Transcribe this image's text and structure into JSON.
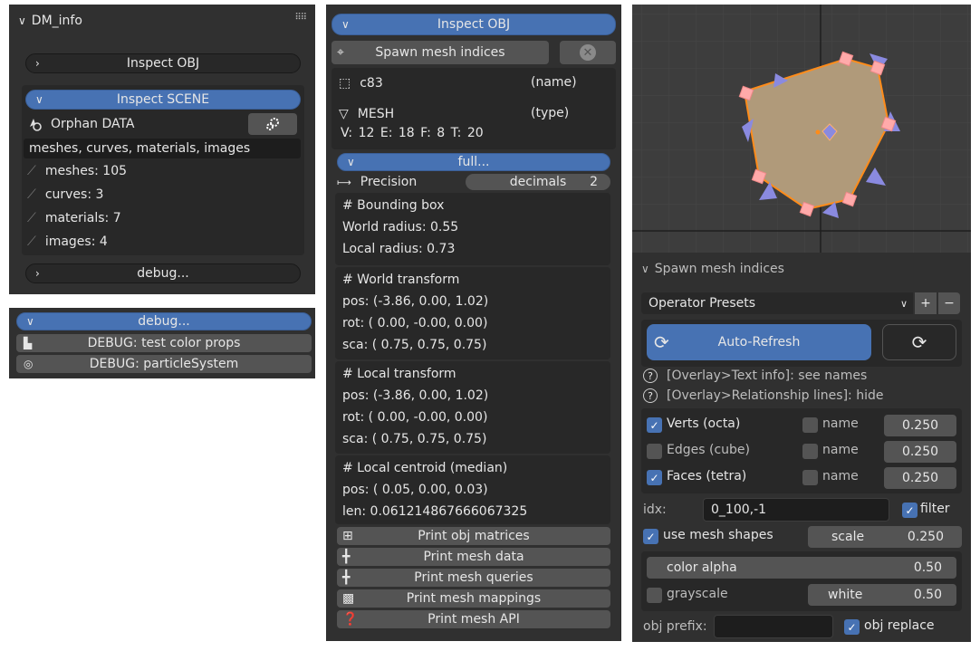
{
  "left": {
    "title": "DM_info",
    "inspect_obj": "Inspect OBJ",
    "inspect_scene": "Inspect SCENE",
    "orphan_label": "Orphan DATA",
    "types_text": "meshes, curves, materials, images",
    "counts": [
      "meshes: 105",
      "curves: 3",
      "materials: 7",
      "images: 4"
    ],
    "debug": "debug..."
  },
  "debug_panel": {
    "header": "debug...",
    "items": [
      "DEBUG: test color props",
      "DEBUG: particleSystem"
    ]
  },
  "middle": {
    "header": "Inspect OBJ",
    "spawn": "Spawn mesh indices",
    "obj_name": "c83",
    "name_tag": "(name)",
    "obj_type": "MESH",
    "type_tag": "(type)",
    "stats": "V: 12   E: 18   F: 8   T: 20",
    "full": "full...",
    "precision_label": "Precision",
    "decimals_label": "decimals",
    "decimals_value": "2",
    "bbox": [
      "# Bounding box",
      "World radius:  0.55",
      "Local radius:  0.73"
    ],
    "world": [
      "# World transform",
      "pos: (-3.86,  0.00,  1.02)",
      "rot:  ( 0.00, -0.00,  0.00)",
      "sca:  ( 0.75,  0.75,  0.75)"
    ],
    "local": [
      "# Local transform",
      "pos: (-3.86,  0.00,  1.02)",
      "rot:  ( 0.00, -0.00,  0.00)",
      "sca:  ( 0.75,  0.75,  0.75)"
    ],
    "centroid": [
      "# Local centroid (median)",
      "pos: ( 0.05,  0.00,  0.03)",
      "len: 0.061214867666067325"
    ],
    "print_buttons": [
      "Print obj matrices",
      "Print mesh data",
      "Print mesh queries",
      "Print mesh mappings",
      "Print mesh API"
    ]
  },
  "right": {
    "panel_title": "Spawn mesh indices",
    "presets": "Operator Presets",
    "plus": "+",
    "minus": "−",
    "auto_refresh": "Auto-Refresh",
    "info1": "[Overlay>Text info]: see names",
    "info2": "[Overlay>Relationship lines]: hide",
    "rows": [
      {
        "label": "Verts (octa)",
        "checked": true,
        "name": "name",
        "value": "0.250"
      },
      {
        "label": "Edges (cube)",
        "checked": false,
        "name": "name",
        "value": "0.250"
      },
      {
        "label": "Faces (tetra)",
        "checked": true,
        "name": "name",
        "value": "0.250"
      }
    ],
    "idx_label": "idx:",
    "idx_value": "0_100,-1",
    "filter": "filter",
    "use_shapes": "use mesh shapes",
    "scale_label": "scale",
    "scale_value": "0.250",
    "color_alpha": "color alpha",
    "color_alpha_value": "0.50",
    "grayscale": "grayscale",
    "white": "white",
    "white_value": "0.50",
    "obj_prefix": "obj prefix:",
    "obj_replace": "obj replace"
  },
  "colors": {
    "accent": "#4772b3",
    "panel": "#303030",
    "button": "#545454",
    "viewport": "#3d3d3d",
    "mesh_fill": "#b09a7a",
    "mesh_edge": "#ff8c1a"
  }
}
